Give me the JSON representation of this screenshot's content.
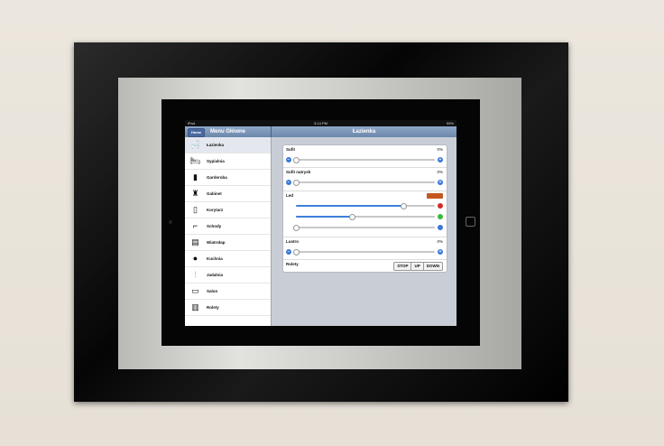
{
  "status_bar": {
    "carrier": "iPad",
    "time": "3:14 PM",
    "battery": "55%"
  },
  "sidebar": {
    "title": "Menu Główne",
    "home_button": "Home",
    "items": [
      {
        "label": "Łazienka",
        "icon": "bathtub-icon",
        "selected": true
      },
      {
        "label": "Sypialnia",
        "icon": "bed-icon",
        "selected": false
      },
      {
        "label": "Garderoba",
        "icon": "wardrobe-icon",
        "selected": false
      },
      {
        "label": "Gabinet",
        "icon": "desk-icon",
        "selected": false
      },
      {
        "label": "Korytarz",
        "icon": "door-icon",
        "selected": false
      },
      {
        "label": "Schody",
        "icon": "stairs-icon",
        "selected": false
      },
      {
        "label": "Wiatrołap",
        "icon": "vestibule-icon",
        "selected": false
      },
      {
        "label": "Kuchnia",
        "icon": "kitchen-icon",
        "selected": false
      },
      {
        "label": "Jadalnia",
        "icon": "cutlery-icon",
        "selected": false
      },
      {
        "label": "Salon",
        "icon": "tv-icon",
        "selected": false
      },
      {
        "label": "Rolety",
        "icon": "blinds-icon",
        "selected": false
      }
    ]
  },
  "detail": {
    "title": "Łazienka",
    "controls": {
      "sufit": {
        "label": "Sufit",
        "value": "0%",
        "level": 0
      },
      "sufit_natrysk": {
        "label": "Sufit natrysk",
        "value": "0%",
        "level": 0
      },
      "led": {
        "label": "Led",
        "swatch_color": "#c4571f",
        "red": 0.77,
        "green": 0.4,
        "blue": 0
      },
      "lustro": {
        "label": "Lustro",
        "value": "0%",
        "level": 0
      },
      "rolety": {
        "label": "Rolety",
        "stop": "STOP",
        "up": "UP",
        "down": "DOWN"
      }
    }
  },
  "colors": {
    "navbar": "#7e98bb",
    "accent": "#3b78d8",
    "detail_bg": "#c9ced6"
  }
}
